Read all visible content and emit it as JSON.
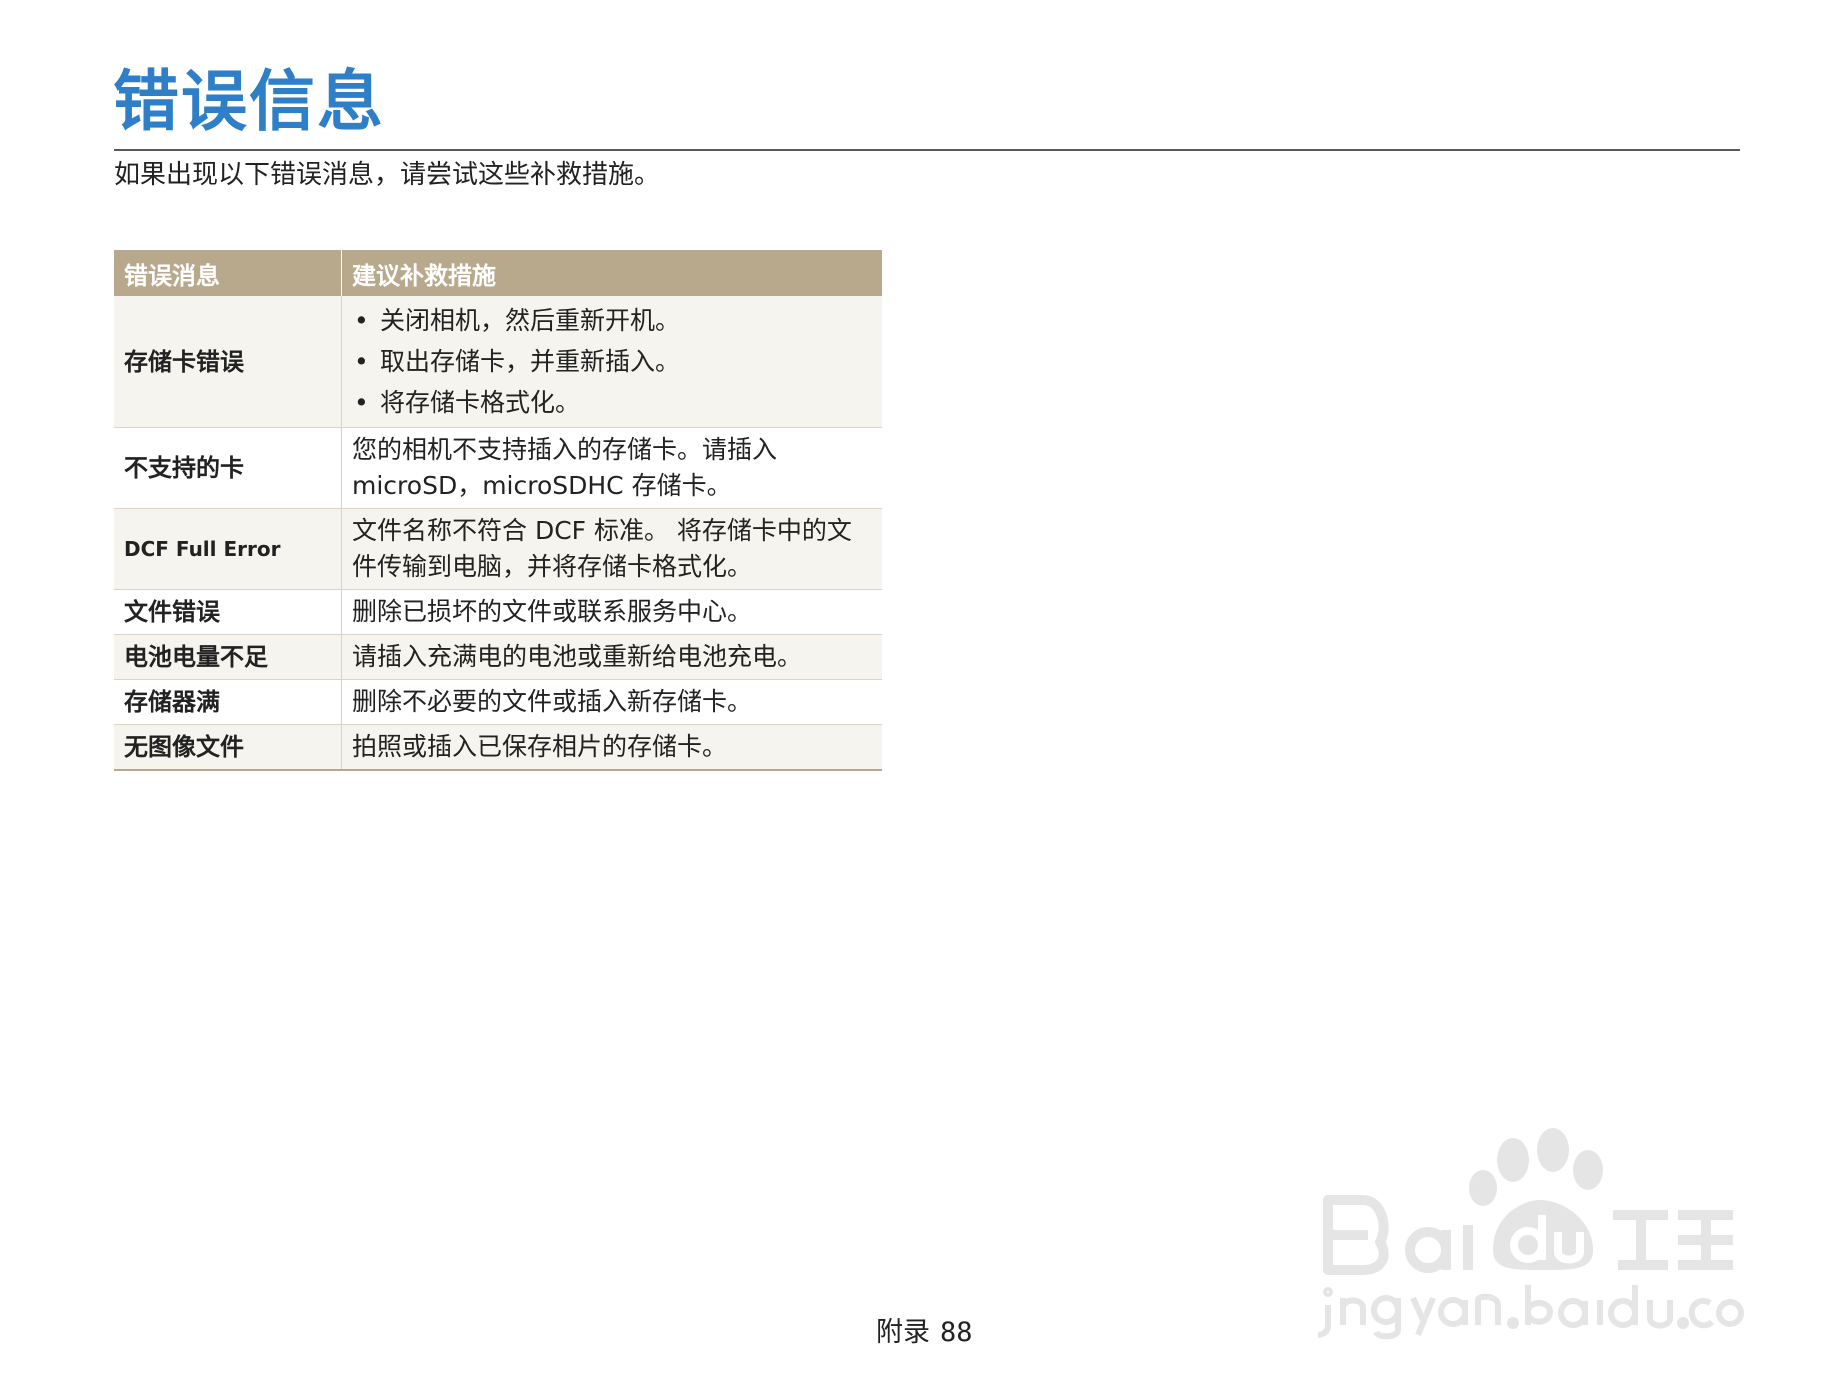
{
  "page": {
    "title": "错误信息",
    "intro": "如果出现以下错误消息，请尝试这些补救措施。"
  },
  "table": {
    "headers": {
      "error": "错误消息",
      "remedy": "建议补救措施"
    },
    "rows": [
      {
        "error": "存储卡错误",
        "remedies": [
          "关闭相机，然后重新开机。",
          "取出存储卡，并重新插入。",
          "将存储卡格式化。"
        ]
      },
      {
        "error": "不支持的卡",
        "remedy": "您的相机不支持插入的存储卡。请插入 microSD，microSDHC 存储卡。"
      },
      {
        "error": "DCF Full Error",
        "remedy": "文件名称不符合 DCF 标准。 将存储卡中的文件传输到电脑，并将存储卡格式化。"
      },
      {
        "error": "文件错误",
        "remedy": "删除已损坏的文件或联系服务中心。"
      },
      {
        "error": "电池电量不足",
        "remedy": "请插入充满电的电池或重新给电池充电。"
      },
      {
        "error": "存储器满",
        "remedy": "删除不必要的文件或插入新存储卡。"
      },
      {
        "error": "无图像文件",
        "remedy": "拍照或插入已保存相片的存储卡。"
      }
    ]
  },
  "footer": {
    "section": "附录",
    "page_number": "88"
  },
  "watermark": {
    "text": "Baidu经验 jingyan.baidu.com",
    "icon": "paw-logo-icon"
  }
}
